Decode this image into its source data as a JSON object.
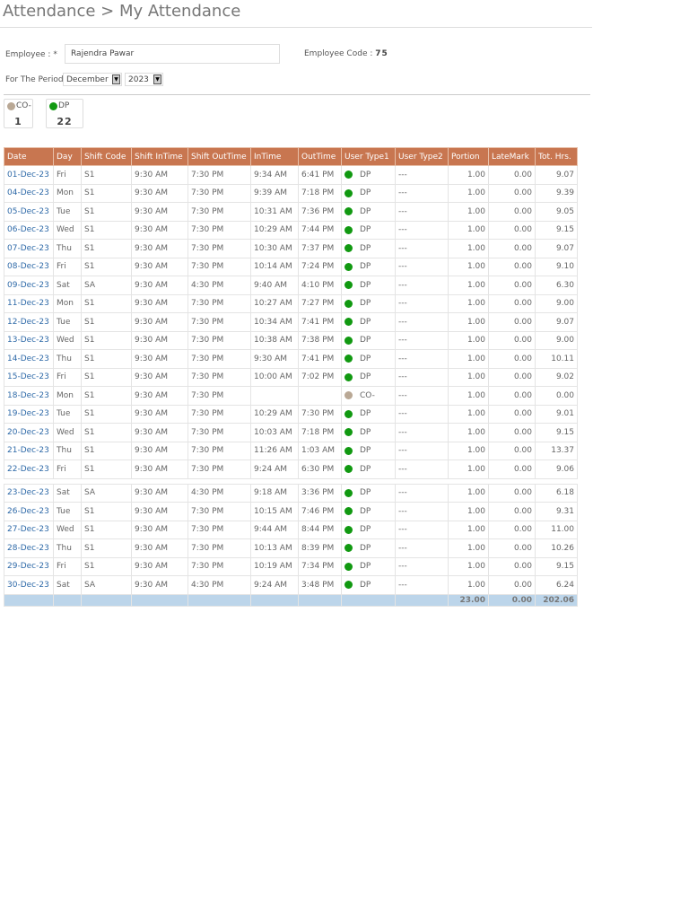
{
  "header": {
    "title": "Attendance > My Attendance"
  },
  "form": {
    "employee_label": "Employee : *",
    "employee_value": "Rajendra Pawar",
    "code_label": "Employee Code :",
    "code_value": "75",
    "period_label": "For The Period",
    "month": "December",
    "year": "2023"
  },
  "summary": [
    {
      "label": "CO-",
      "count": "1",
      "color": "#b9a895"
    },
    {
      "label": "DP",
      "count": "22",
      "color": "#119911"
    }
  ],
  "colors": {
    "header_bg": "#c87650",
    "total_bg": "#bcd5ea",
    "dp": "#119911",
    "co": "#b9a895"
  },
  "table": {
    "columns": [
      "Date",
      "Day",
      "Shift Code",
      "Shift InTime",
      "Shift OutTime",
      "InTime",
      "OutTime",
      "User Type1",
      "User Type2",
      "Portion",
      "LateMark",
      "Tot. Hrs."
    ],
    "rows": [
      [
        "01-Dec-23",
        "Fri",
        "S1",
        "9:30 AM",
        "7:30 PM",
        "9:34 AM",
        "6:41 PM",
        "DP",
        "---",
        "1.00",
        "0.00",
        "9.07"
      ],
      [
        "04-Dec-23",
        "Mon",
        "S1",
        "9:30 AM",
        "7:30 PM",
        "9:39 AM",
        "7:18 PM",
        "DP",
        "---",
        "1.00",
        "0.00",
        "9.39"
      ],
      [
        "05-Dec-23",
        "Tue",
        "S1",
        "9:30 AM",
        "7:30 PM",
        "10:31 AM",
        "7:36 PM",
        "DP",
        "---",
        "1.00",
        "0.00",
        "9.05"
      ],
      [
        "06-Dec-23",
        "Wed",
        "S1",
        "9:30 AM",
        "7:30 PM",
        "10:29 AM",
        "7:44 PM",
        "DP",
        "---",
        "1.00",
        "0.00",
        "9.15"
      ],
      [
        "07-Dec-23",
        "Thu",
        "S1",
        "9:30 AM",
        "7:30 PM",
        "10:30 AM",
        "7:37 PM",
        "DP",
        "---",
        "1.00",
        "0.00",
        "9.07"
      ],
      [
        "08-Dec-23",
        "Fri",
        "S1",
        "9:30 AM",
        "7:30 PM",
        "10:14 AM",
        "7:24 PM",
        "DP",
        "---",
        "1.00",
        "0.00",
        "9.10"
      ],
      [
        "09-Dec-23",
        "Sat",
        "SA",
        "9:30 AM",
        "4:30 PM",
        "9:40 AM",
        "4:10 PM",
        "DP",
        "---",
        "1.00",
        "0.00",
        "6.30"
      ],
      [
        "11-Dec-23",
        "Mon",
        "S1",
        "9:30 AM",
        "7:30 PM",
        "10:27 AM",
        "7:27 PM",
        "DP",
        "---",
        "1.00",
        "0.00",
        "9.00"
      ],
      [
        "12-Dec-23",
        "Tue",
        "S1",
        "9:30 AM",
        "7:30 PM",
        "10:34 AM",
        "7:41 PM",
        "DP",
        "---",
        "1.00",
        "0.00",
        "9.07"
      ],
      [
        "13-Dec-23",
        "Wed",
        "S1",
        "9:30 AM",
        "7:30 PM",
        "10:38 AM",
        "7:38 PM",
        "DP",
        "---",
        "1.00",
        "0.00",
        "9.00"
      ],
      [
        "14-Dec-23",
        "Thu",
        "S1",
        "9:30 AM",
        "7:30 PM",
        "9:30 AM",
        "7:41 PM",
        "DP",
        "---",
        "1.00",
        "0.00",
        "10.11"
      ],
      [
        "15-Dec-23",
        "Fri",
        "S1",
        "9:30 AM",
        "7:30 PM",
        "10:00 AM",
        "7:02 PM",
        "DP",
        "---",
        "1.00",
        "0.00",
        "9.02"
      ],
      [
        "18-Dec-23",
        "Mon",
        "S1",
        "9:30 AM",
        "7:30 PM",
        "",
        "",
        "CO-",
        "---",
        "1.00",
        "0.00",
        "0.00"
      ],
      [
        "19-Dec-23",
        "Tue",
        "S1",
        "9:30 AM",
        "7:30 PM",
        "10:29 AM",
        "7:30 PM",
        "DP",
        "---",
        "1.00",
        "0.00",
        "9.01"
      ],
      [
        "20-Dec-23",
        "Wed",
        "S1",
        "9:30 AM",
        "7:30 PM",
        "10:03 AM",
        "7:18 PM",
        "DP",
        "---",
        "1.00",
        "0.00",
        "9.15"
      ],
      [
        "21-Dec-23",
        "Thu",
        "S1",
        "9:30 AM",
        "7:30 PM",
        "11:26 AM",
        "1:03 AM",
        "DP",
        "---",
        "1.00",
        "0.00",
        "13.37"
      ],
      [
        "22-Dec-23",
        "Fri",
        "S1",
        "9:30 AM",
        "7:30 PM",
        "9:24 AM",
        "6:30 PM",
        "DP",
        "---",
        "1.00",
        "0.00",
        "9.06"
      ],
      [
        "23-Dec-23",
        "Sat",
        "SA",
        "9:30 AM",
        "4:30 PM",
        "9:18 AM",
        "3:36 PM",
        "DP",
        "---",
        "1.00",
        "0.00",
        "6.18"
      ],
      [
        "26-Dec-23",
        "Tue",
        "S1",
        "9:30 AM",
        "7:30 PM",
        "10:15 AM",
        "7:46 PM",
        "DP",
        "---",
        "1.00",
        "0.00",
        "9.31"
      ],
      [
        "27-Dec-23",
        "Wed",
        "S1",
        "9:30 AM",
        "7:30 PM",
        "9:44 AM",
        "8:44 PM",
        "DP",
        "---",
        "1.00",
        "0.00",
        "11.00"
      ],
      [
        "28-Dec-23",
        "Thu",
        "S1",
        "9:30 AM",
        "7:30 PM",
        "10:13 AM",
        "8:39 PM",
        "DP",
        "---",
        "1.00",
        "0.00",
        "10.26"
      ],
      [
        "29-Dec-23",
        "Fri",
        "S1",
        "9:30 AM",
        "7:30 PM",
        "10:19 AM",
        "7:34 PM",
        "DP",
        "---",
        "1.00",
        "0.00",
        "9.15"
      ],
      [
        "30-Dec-23",
        "Sat",
        "SA",
        "9:30 AM",
        "4:30 PM",
        "9:24 AM",
        "3:48 PM",
        "DP",
        "---",
        "1.00",
        "0.00",
        "6.24"
      ]
    ],
    "totals": {
      "portion": "23.00",
      "latemark": "0.00",
      "tot_hrs": "202.06"
    }
  }
}
